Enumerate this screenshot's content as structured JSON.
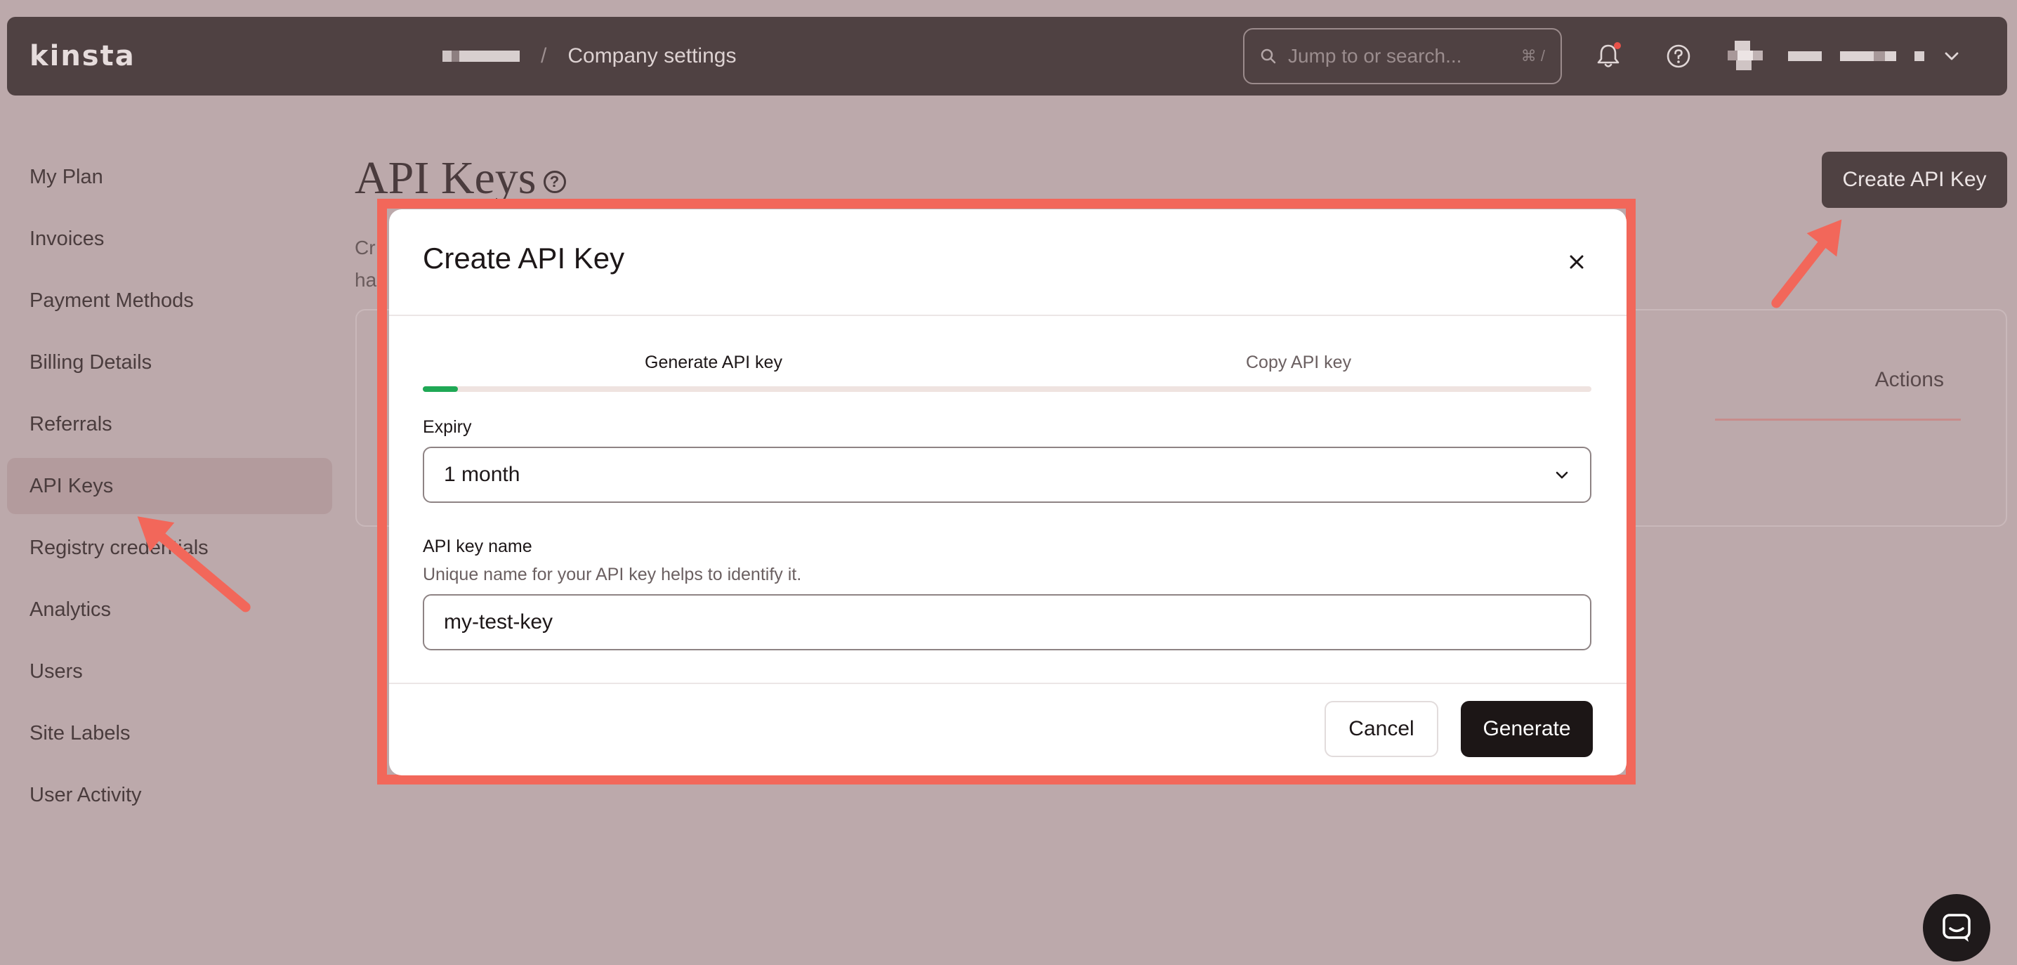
{
  "app": {
    "logo": "kinsta",
    "breadcrumb_current": "Company settings",
    "breadcrumb_sep": "/"
  },
  "search": {
    "placeholder": "Jump to or search...",
    "shortcut": "⌘ /"
  },
  "sidebar": {
    "items": [
      {
        "label": "My Plan"
      },
      {
        "label": "Invoices"
      },
      {
        "label": "Payment Methods"
      },
      {
        "label": "Billing Details"
      },
      {
        "label": "Referrals"
      },
      {
        "label": "API Keys",
        "active": true
      },
      {
        "label": "Registry credentials"
      },
      {
        "label": "Analytics"
      },
      {
        "label": "Users"
      },
      {
        "label": "Site Labels"
      },
      {
        "label": "User Activity"
      }
    ]
  },
  "main": {
    "title": "API Keys",
    "help_glyph": "?",
    "description_line1": "Cr",
    "description_line2": "ha",
    "create_button": "Create API Key",
    "table_actions_header": "Actions"
  },
  "modal": {
    "title": "Create API Key",
    "steps": [
      {
        "label": "Generate API key",
        "active": true
      },
      {
        "label": "Copy API key",
        "active": false
      }
    ],
    "progress": 0.03,
    "expiry": {
      "label": "Expiry",
      "value": "1 month"
    },
    "name_field": {
      "label": "API key name",
      "hint": "Unique name for your API key helps to identify it.",
      "value": "my-test-key"
    },
    "cancel_label": "Cancel",
    "generate_label": "Generate"
  },
  "colors": {
    "topbar": "#4f4142",
    "background": "#bca9ab",
    "highlight": "#f2675a",
    "progress": "#1fa855",
    "primary_button": "#1c1616"
  }
}
